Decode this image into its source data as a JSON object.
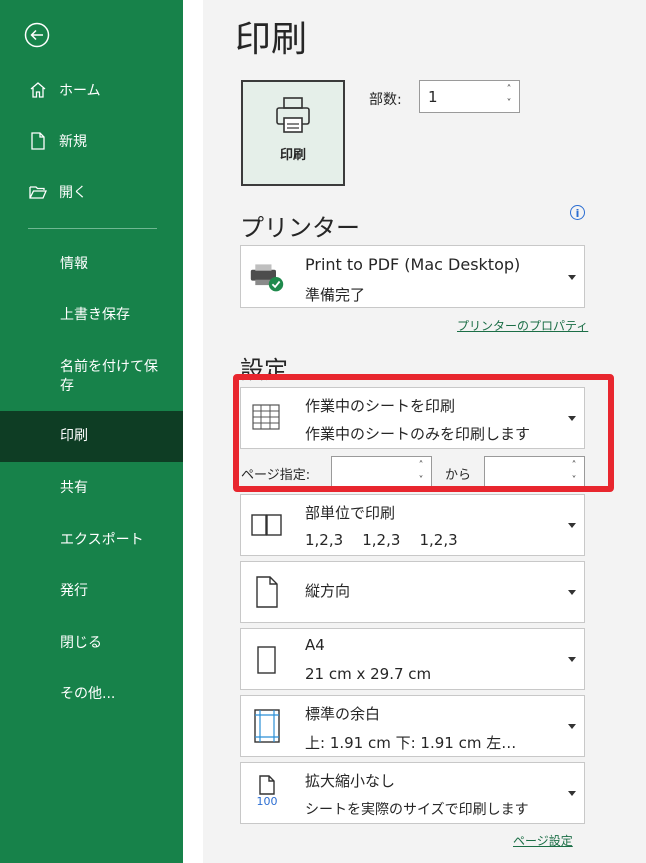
{
  "sidebar": {
    "back_icon": "back-arrow-icon",
    "items": [
      {
        "label": "ホーム",
        "icon": "home-icon"
      },
      {
        "label": "新規",
        "icon": "new-file-icon"
      },
      {
        "label": "開く",
        "icon": "open-folder-icon"
      }
    ],
    "sub_items": [
      {
        "label": "情報"
      },
      {
        "label": "上書き保存"
      },
      {
        "label": "名前を付けて保存"
      },
      {
        "label": "印刷",
        "active": true
      },
      {
        "label": "共有"
      },
      {
        "label": "エクスポート"
      },
      {
        "label": "発行"
      },
      {
        "label": "閉じる"
      },
      {
        "label": "その他..."
      }
    ],
    "colors": {
      "bg": "#17824a",
      "active_bg": "#0e3d24"
    }
  },
  "main": {
    "title": "印刷",
    "print_button_label": "印刷",
    "copies_label": "部数:",
    "copies_value": "1",
    "printer": {
      "heading": "プリンター",
      "name": "Print to PDF (Mac Desktop)",
      "status": "準備完了",
      "properties_link": "プリンターのプロパティ"
    },
    "settings": {
      "heading": "設定",
      "print_what": {
        "line1": "作業中のシートを印刷",
        "line2": "作業中のシートのみを印刷します"
      },
      "pages_label": "ページ指定:",
      "pages_to_label": "から",
      "collate": {
        "line1": "部単位で印刷",
        "line2": "1,2,3    1,2,3    1,2,3"
      },
      "orientation": {
        "line1": "縦方向"
      },
      "paper": {
        "line1": "A4",
        "line2": "21 cm x 29.7 cm"
      },
      "margins": {
        "line1": "標準の余白",
        "line2": "上: 1.91 cm 下: 1.91 cm 左…"
      },
      "scaling": {
        "line1": "拡大縮小なし",
        "line2": "シートを実際のサイズで印刷します",
        "icon_text": "100"
      },
      "page_setup_link": "ページ設定"
    },
    "highlight_color": "#e8262e"
  }
}
